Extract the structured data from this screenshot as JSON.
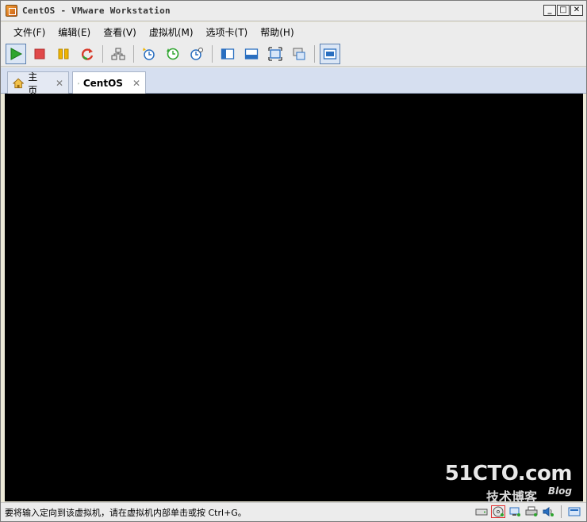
{
  "window": {
    "title": "CentOS - VMware Workstation",
    "buttons": {
      "minimize": "_",
      "maximize": "□",
      "close": "✕"
    }
  },
  "menu": [
    {
      "label": "文件(F)"
    },
    {
      "label": "编辑(E)"
    },
    {
      "label": "查看(V)"
    },
    {
      "label": "虚拟机(M)"
    },
    {
      "label": "选项卡(T)"
    },
    {
      "label": "帮助(H)"
    }
  ],
  "tabs": [
    {
      "label": "主页",
      "icon": "home-icon",
      "selected": false
    },
    {
      "label": "CentOS",
      "icon": "vm-icon",
      "selected": true
    }
  ],
  "status": {
    "message": "要将输入定向到该虚拟机，请在虚拟机内部单击或按 Ctrl+G。"
  },
  "watermark": {
    "logo": "51CTO.com",
    "sub": "技术博客",
    "blog": "Blog"
  },
  "colors": {
    "play": "#2fa52f",
    "stop": "#e04848",
    "pause": "#f0b400",
    "reset": "#d83a2a",
    "accent_blue": "#2a6fc0",
    "tab_strip": "#d6dff0"
  }
}
